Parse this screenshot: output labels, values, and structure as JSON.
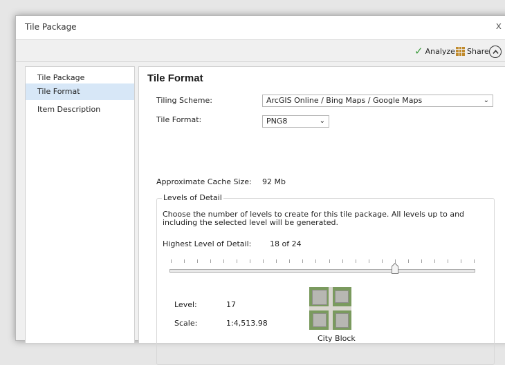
{
  "window": {
    "title": "Tile Package",
    "close_glyph": "x"
  },
  "toolbar": {
    "analyze_label": "Analyze",
    "share_label": "Share"
  },
  "sidebar": {
    "items": [
      {
        "label": "Tile Package",
        "active": false
      },
      {
        "label": "Tile Format",
        "active": true
      },
      {
        "label": "Item Description",
        "active": false
      }
    ]
  },
  "main": {
    "title": "Tile Format",
    "tiling_scheme": {
      "label": "Tiling Scheme:",
      "value": "ArcGIS Online / Bing Maps / Google Maps"
    },
    "tile_format": {
      "label": "Tile Format:",
      "value": "PNG8"
    },
    "cache_size": {
      "label": "Approximate Cache Size:",
      "value": "92 Mb"
    },
    "levels": {
      "legend": "Levels of Detail",
      "description": "Choose the number of levels to create for this tile package.   All levels up to and including the selected level will be generated.",
      "highest_label": "Highest Level of Detail:",
      "highest_value": "18 of 24",
      "slider": {
        "value": 18,
        "max": 24
      },
      "level_label": "Level:",
      "level_value": "17",
      "scale_label": "Scale:",
      "scale_value": "1:4,513.98",
      "preview_caption": "City Block"
    }
  },
  "colors": {
    "active_nav": "#d7e7f7",
    "check": "#3a9a3a"
  },
  "icons": {
    "analyze": "checkmark-icon",
    "share": "grid-package-icon",
    "collapse": "chevron-up-circle-icon"
  }
}
